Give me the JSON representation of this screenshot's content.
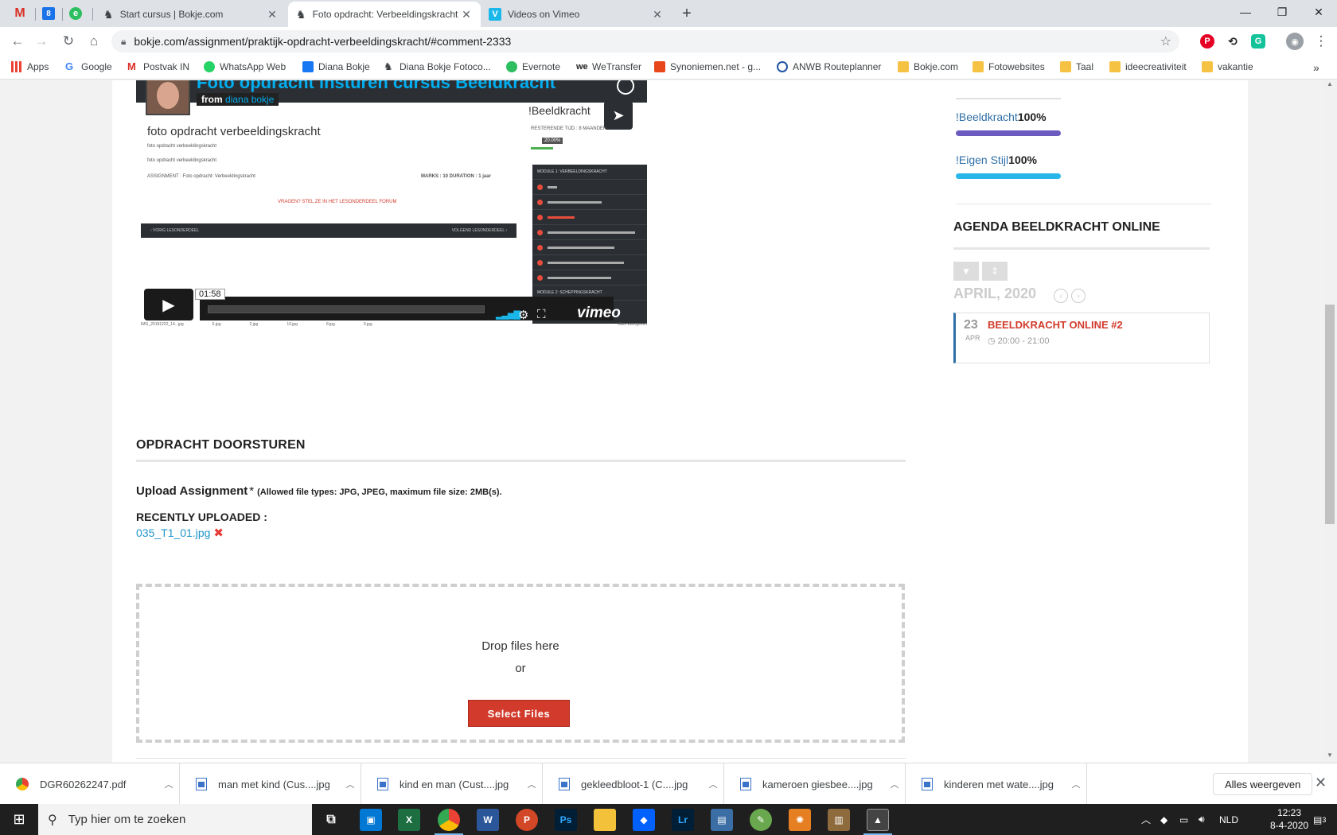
{
  "tabs": {
    "pinned": [
      {
        "icon": "gmail-icon",
        "glyph": "M"
      },
      {
        "icon": "calendar-icon",
        "glyph": "8"
      },
      {
        "icon": "evernote-icon",
        "glyph": "e"
      }
    ],
    "items": [
      {
        "title": "Start cursus | Bokje.com",
        "active": false
      },
      {
        "title": "Foto opdracht: Verbeeldingskracht",
        "active": true
      },
      {
        "title": "Videos on Vimeo",
        "active": false
      }
    ],
    "new_tab": "+"
  },
  "window_controls": {
    "minimize": "—",
    "restore": "❐",
    "close": "✕"
  },
  "omnibox": {
    "url": "bokje.com/assignment/praktijk-opdracht-verbeeldingskracht/#comment-2333"
  },
  "bookmarks": [
    {
      "label": "Apps",
      "icon": "apps-icon"
    },
    {
      "label": "Google",
      "icon": "google-icon"
    },
    {
      "label": "Postvak IN",
      "icon": "gmail-icon"
    },
    {
      "label": "WhatsApp Web",
      "icon": "whatsapp-icon"
    },
    {
      "label": "Diana Bokje",
      "icon": "facebook-icon"
    },
    {
      "label": "Diana Bokje Fotoco...",
      "icon": "horse-icon"
    },
    {
      "label": "Evernote",
      "icon": "evernote-icon"
    },
    {
      "label": "WeTransfer",
      "icon": "wetransfer-icon"
    },
    {
      "label": "Synoniemen.net - g...",
      "icon": "synoniemen-icon"
    },
    {
      "label": "ANWB Routeplanner",
      "icon": "anwb-icon"
    },
    {
      "label": "Bokje.com",
      "icon": "folder-icon"
    },
    {
      "label": "Fotowebsites",
      "icon": "folder-icon"
    },
    {
      "label": "Taal",
      "icon": "folder-icon"
    },
    {
      "label": "ideecreativiteit",
      "icon": "folder-icon"
    },
    {
      "label": "vakantie",
      "icon": "folder-icon"
    }
  ],
  "bookmarks_more": "»",
  "video": {
    "title": "Foto opdracht insturen cursus Beeldkracht",
    "from_prefix": "from",
    "author": "diana bokje",
    "heading": "foto opdracht verbeeldingskracht",
    "line1": "foto opdracht verbeeldingskracht",
    "line2": "foto opdracht verbeeldingskracht",
    "assignment_line": "ASSIGNMENT : Foto opdracht: Verbeeldingskracht",
    "marks_line": "MARKS : 10   DURATION : 1 jaar",
    "forum_line": "VRAGEN? STEL ZE IN HET LESONDERDEEL FORUM",
    "prev_lesson": "‹ VORIG LESONDERDEEL",
    "next_lesson": "VOLGEND LESONDERDEEL ›",
    "course_name": "!Beeldkracht",
    "remaining": "RESTERENDE TIJD : 8 MAANDEN",
    "progress_badge": "20.00%",
    "module_title": "MODULE 1: VERBEELDINGSKRACHT",
    "module2_title": "MODULE 2: SCHEPPINGSKRACHT",
    "time": "01:58",
    "brand": "vimeo",
    "downloads": [
      "IMG_20181222_14...jpg",
      "6.jpg",
      "2.jpg",
      "10.jpg",
      "8.jpg",
      "9.jpg",
      "Alles weergeven"
    ]
  },
  "assignment": {
    "section_title": "OPDRACHT DOORSTUREN",
    "upload_label": "Upload Assignment",
    "required_mark": "*",
    "allowed_hint": "(Allowed file types: JPG, JPEG, maximum file size: 2MB(s).",
    "recent_label": "RECENTLY UPLOADED :",
    "recent_file": "035_T1_01.jpg",
    "delete_glyph": "✖",
    "drop_text": "Drop files here",
    "or_text": "or",
    "select_button": "Select Files"
  },
  "sidebar": {
    "courses": [
      {
        "name": "!Beeldkracht",
        "percent_label": "100%",
        "percent": 100,
        "color": "#6c5bbf"
      },
      {
        "name": "!Eigen Stijl",
        "percent_label": "100%",
        "percent": 100,
        "color": "#29b6e8"
      }
    ],
    "agenda_title": "AGENDA BEELDKRACHT ONLINE",
    "month": "APRIL, 2020",
    "event": {
      "day": "23",
      "month": "APR",
      "title": "BEELDKRACHT ONLINE #2",
      "time": "20:00 - 21:00"
    }
  },
  "downloads_shelf": {
    "items": [
      {
        "name": "DGR60262247.pdf",
        "icon": "chrome-pdf-icon"
      },
      {
        "name": "man met kind (Cus....jpg",
        "icon": "image-file-icon"
      },
      {
        "name": "kind en man (Cust....jpg",
        "icon": "image-file-icon"
      },
      {
        "name": "gekleedbloot-1 (C....jpg",
        "icon": "image-file-icon"
      },
      {
        "name": "kameroen giesbee....jpg",
        "icon": "image-file-icon"
      },
      {
        "name": "kinderen met wate....jpg",
        "icon": "image-file-icon"
      }
    ],
    "show_all": "Alles weergeven"
  },
  "taskbar": {
    "search_placeholder": "Typ hier om te zoeken",
    "language": "NLD",
    "time": "12:23",
    "date": "8-4-2020",
    "notifications": "3"
  }
}
